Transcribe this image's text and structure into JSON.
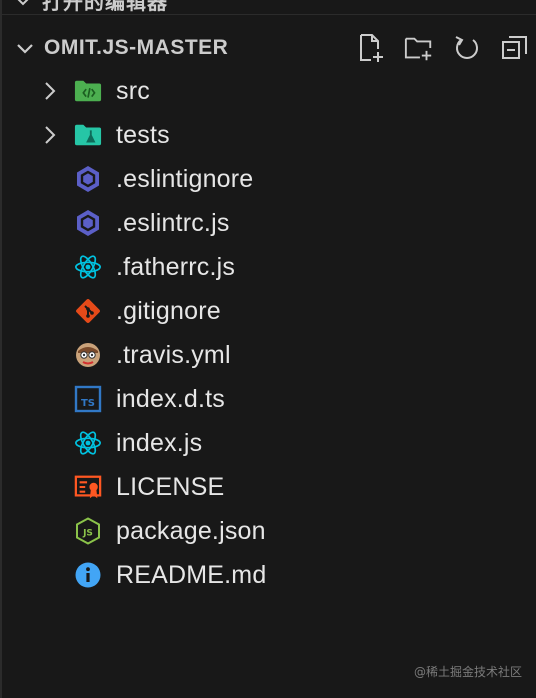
{
  "open_editors": {
    "label": "打开的编辑器"
  },
  "explorer": {
    "title": "OMIT.JS-MASTER",
    "actions": [
      {
        "name": "new-file-button",
        "icon": "new-file-icon"
      },
      {
        "name": "new-folder-button",
        "icon": "new-folder-icon"
      },
      {
        "name": "refresh-button",
        "icon": "refresh-icon"
      },
      {
        "name": "collapse-all-button",
        "icon": "collapse-all-icon"
      }
    ]
  },
  "tree": {
    "items": [
      {
        "label": "src",
        "type": "folder",
        "icon": "folder-src-icon"
      },
      {
        "label": "tests",
        "type": "folder",
        "icon": "folder-test-icon"
      },
      {
        "label": ".eslintignore",
        "type": "file",
        "icon": "eslint-icon"
      },
      {
        "label": ".eslintrc.js",
        "type": "file",
        "icon": "eslint-icon"
      },
      {
        "label": ".fatherrc.js",
        "type": "file",
        "icon": "react-icon"
      },
      {
        "label": ".gitignore",
        "type": "file",
        "icon": "git-icon"
      },
      {
        "label": ".travis.yml",
        "type": "file",
        "icon": "travis-icon"
      },
      {
        "label": "index.d.ts",
        "type": "file",
        "icon": "typescript-icon"
      },
      {
        "label": "index.js",
        "type": "file",
        "icon": "react-icon"
      },
      {
        "label": "LICENSE",
        "type": "file",
        "icon": "license-icon"
      },
      {
        "label": "package.json",
        "type": "file",
        "icon": "nodejs-icon"
      },
      {
        "label": "README.md",
        "type": "file",
        "icon": "info-icon"
      }
    ]
  },
  "watermark": "@稀土掘金技术社区",
  "colors": {
    "background": "#181818",
    "text": "#e6e6e6",
    "folder_green": "#4caf50",
    "folder_teal": "#26c6a6",
    "eslint": "#5b5fc7",
    "react": "#00c2e0",
    "git": "#e64a19",
    "typescript": "#3178c6",
    "license": "#ff5722",
    "nodejs": "#8bc34a",
    "info": "#42a5f5"
  }
}
